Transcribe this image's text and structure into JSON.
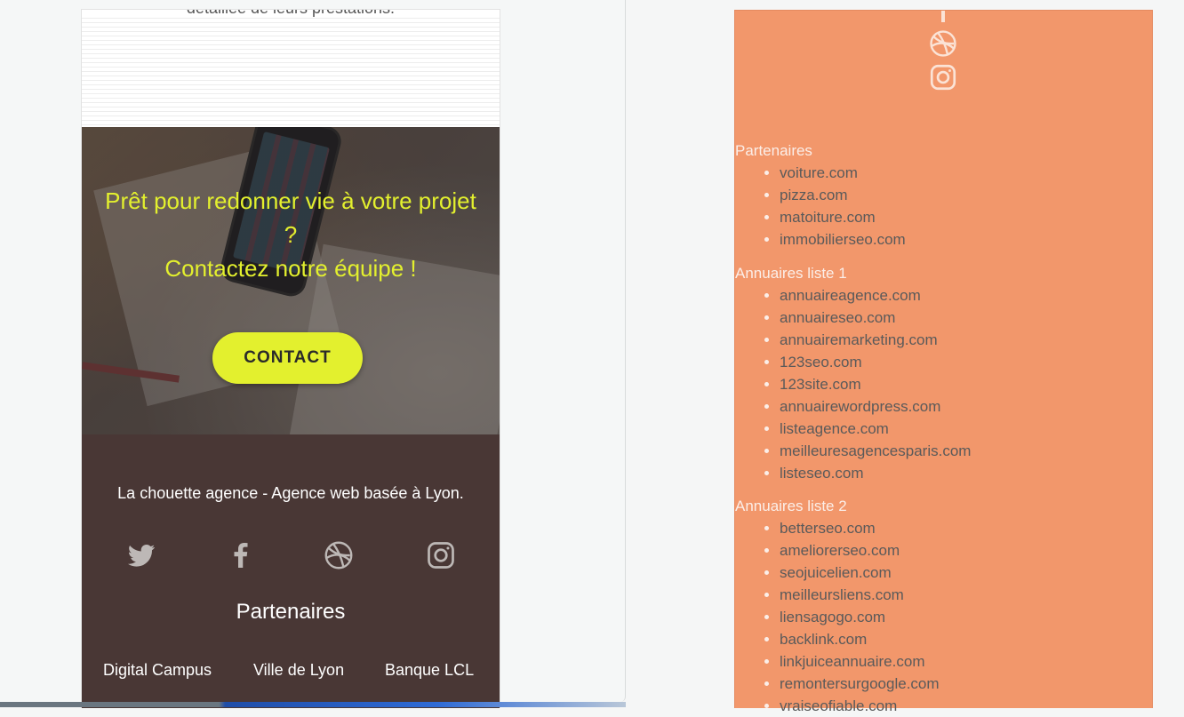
{
  "mobile_preview": {
    "intro_text": "détaillée de leurs prestations.",
    "hero": {
      "heading_line1": "Prêt pour redonner vie à votre projet",
      "heading_line2": "?",
      "heading_line3": "Contactez notre équipe !",
      "cta_label": "CONTACT"
    },
    "footer": {
      "tagline": "La chouette agence - Agence web basée à Lyon.",
      "social_icons": [
        "twitter-icon",
        "facebook-icon",
        "dribbble-icon",
        "instagram-icon"
      ],
      "partners_title": "Partenaires",
      "partners": [
        "Digital Campus",
        "Ville de Lyon",
        "Banque LCL"
      ]
    }
  },
  "footer_panel": {
    "icons": [
      "dribbble-icon",
      "instagram-icon"
    ],
    "sections": [
      {
        "title": "Partenaires",
        "items": [
          "voiture.com",
          "pizza.com",
          "matoiture.com",
          "immobilierseo.com"
        ]
      },
      {
        "title": "Annuaires liste 1",
        "items": [
          "annuaireagence.com",
          "annuaireseo.com",
          "annuairemarketing.com",
          "123seo.com",
          "123site.com",
          "annuairewordpress.com",
          "listeagence.com",
          "meilleuresagencesparis.com",
          "listeseo.com"
        ]
      },
      {
        "title": "Annuaires liste 2",
        "items": [
          "betterseo.com",
          "ameliorerseo.com",
          "seojuicelien.com",
          "meilleursliens.com",
          "liensagogo.com",
          "backlink.com",
          "linkjuiceannuaire.com",
          "remontersurgoogle.com",
          "vraiseofiable.com"
        ]
      }
    ]
  },
  "colors": {
    "hero_text": "#e3f02e",
    "cta_background": "#e3f02e",
    "footer_background": "#493735",
    "panel_background": "#f2976b",
    "panel_heading": "#fbeee8",
    "panel_link": "#5a5a5a"
  }
}
